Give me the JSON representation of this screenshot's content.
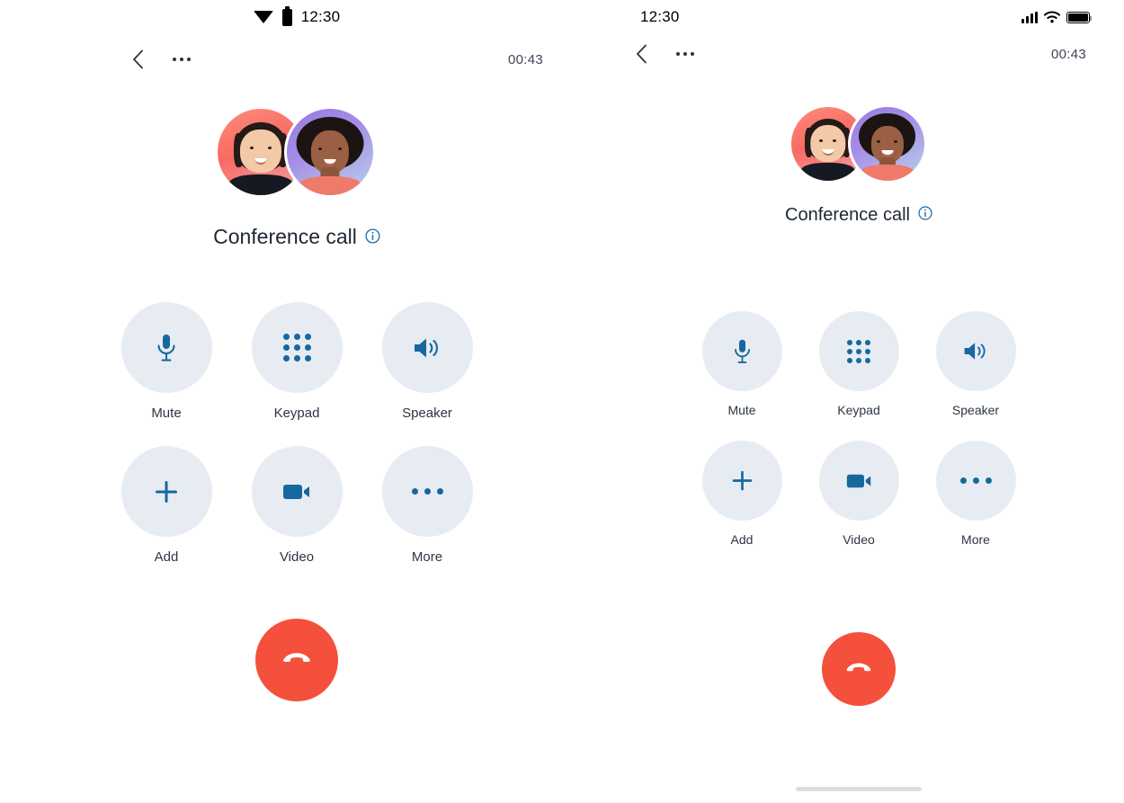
{
  "screens": [
    {
      "platform": "android",
      "status_bar": {
        "time": "12:30",
        "icons": [
          "wifi-triangle-icon",
          "battery-icon"
        ]
      },
      "nav": {
        "back_icon": "chevron-left-icon",
        "menu_icon": "overflow-menu-icon",
        "timer": "00:43"
      },
      "call": {
        "title": "Conference call",
        "info_icon": "info-circle-icon",
        "participants": [
          {
            "name": "participant-1-avatar",
            "ring_color": "#f8736a"
          },
          {
            "name": "participant-2-avatar",
            "ring_color": "#a58ce6"
          }
        ]
      },
      "controls": [
        [
          {
            "id": "mute",
            "label": "Mute",
            "icon": "microphone-icon"
          },
          {
            "id": "keypad",
            "label": "Keypad",
            "icon": "keypad-icon"
          },
          {
            "id": "speaker",
            "label": "Speaker",
            "icon": "speaker-icon"
          }
        ],
        [
          {
            "id": "add",
            "label": "Add",
            "icon": "plus-icon"
          },
          {
            "id": "video",
            "label": "Video",
            "icon": "video-camera-icon"
          },
          {
            "id": "more",
            "label": "More",
            "icon": "ellipsis-icon"
          }
        ]
      ],
      "end_call": {
        "icon": "hangup-phone-icon",
        "color": "#f5503c",
        "label": "End call"
      },
      "home_indicator": false
    },
    {
      "platform": "ios",
      "status_bar": {
        "time": "12:30",
        "icons": [
          "cellular-signal-icon",
          "wifi-icon",
          "battery-icon"
        ]
      },
      "nav": {
        "back_icon": "chevron-left-icon",
        "menu_icon": "overflow-menu-icon",
        "timer": "00:43"
      },
      "call": {
        "title": "Conference call",
        "info_icon": "info-circle-icon",
        "participants": [
          {
            "name": "participant-1-avatar",
            "ring_color": "#f8736a"
          },
          {
            "name": "participant-2-avatar",
            "ring_color": "#a58ce6"
          }
        ]
      },
      "controls": [
        [
          {
            "id": "mute",
            "label": "Mute",
            "icon": "microphone-icon"
          },
          {
            "id": "keypad",
            "label": "Keypad",
            "icon": "keypad-icon"
          },
          {
            "id": "speaker",
            "label": "Speaker",
            "icon": "speaker-icon"
          }
        ],
        [
          {
            "id": "add",
            "label": "Add",
            "icon": "plus-icon"
          },
          {
            "id": "video",
            "label": "Video",
            "icon": "video-camera-icon"
          },
          {
            "id": "more",
            "label": "More",
            "icon": "ellipsis-icon"
          }
        ]
      ],
      "end_call": {
        "icon": "hangup-phone-icon",
        "color": "#f5503c",
        "label": "End call"
      },
      "home_indicator": true
    }
  ],
  "theme": {
    "accent_blue": "#17689e",
    "control_bg": "#e7ecf3",
    "end_call_red": "#f5503c",
    "text_primary": "#1e2732",
    "background": "#ffffff"
  }
}
